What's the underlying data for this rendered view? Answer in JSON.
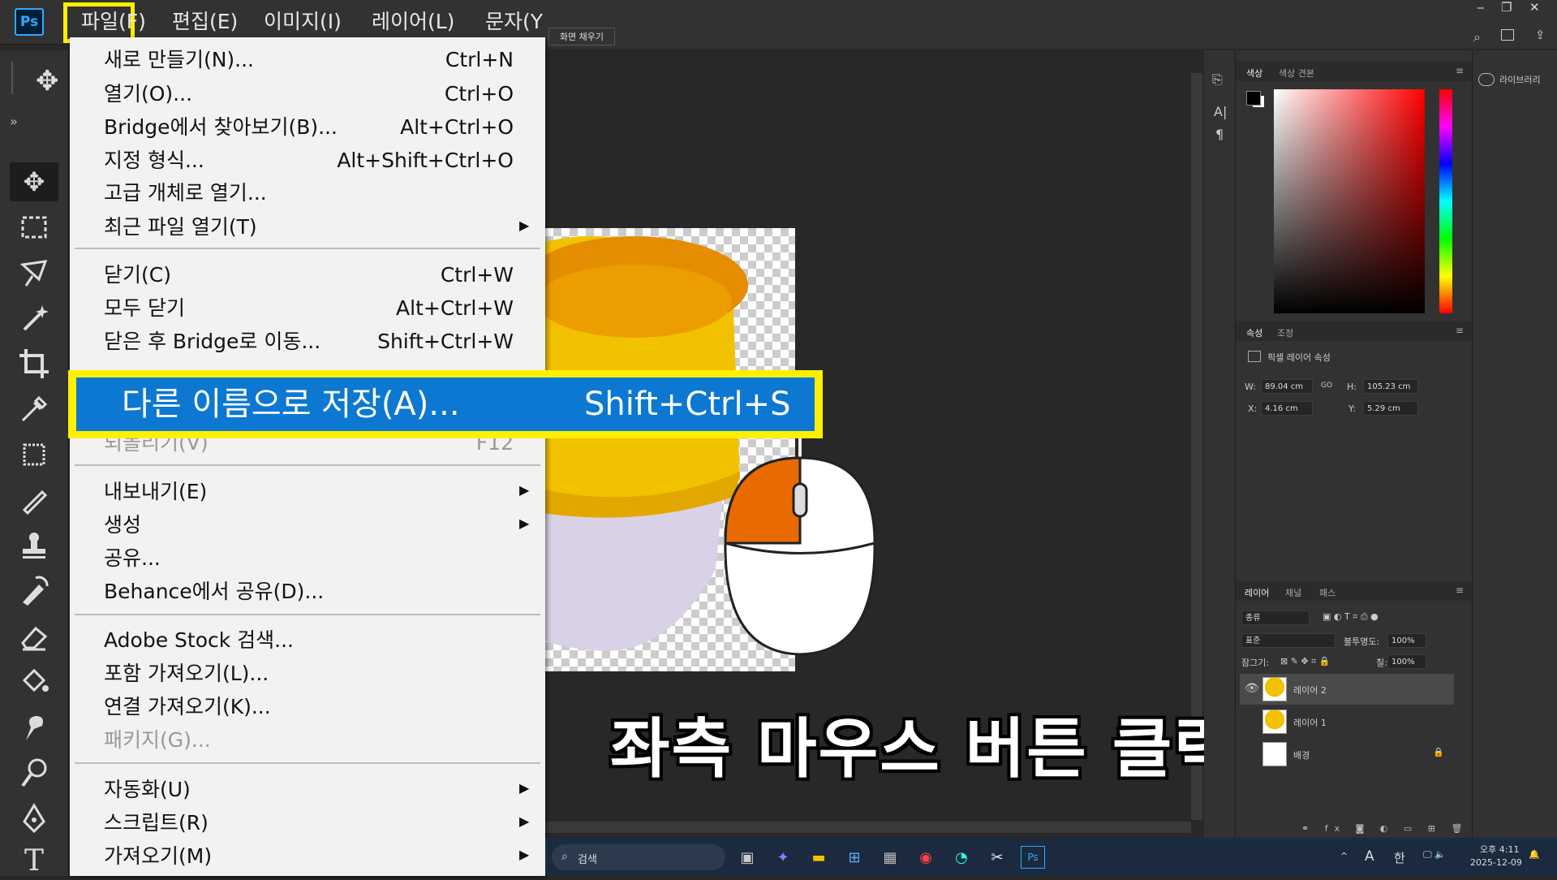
{
  "app": {
    "logo": "Ps"
  },
  "menubar": [
    "파일(F)",
    "편집(E)",
    "이미지(I)",
    "레이어(L)",
    "문자(Y"
  ],
  "window_controls": [
    "‒",
    "❐",
    "✕"
  ],
  "options_bar": {
    "fill_button": "화면 채우기"
  },
  "file_menu": {
    "items": [
      {
        "label": "새로 만들기(N)...",
        "shortcut": "Ctrl+N"
      },
      {
        "label": "열기(O)...",
        "shortcut": "Ctrl+O"
      },
      {
        "label": "Bridge에서 찾아보기(B)...",
        "shortcut": "Alt+Ctrl+O"
      },
      {
        "label": "지정 형식...",
        "shortcut": "Alt+Shift+Ctrl+O"
      },
      {
        "label": "고급 개체로 열기...",
        "shortcut": ""
      },
      {
        "label": "최근 파일 열기(T)",
        "shortcut": ""
      },
      {
        "label": "닫기(C)",
        "shortcut": "Ctrl+W"
      },
      {
        "label": "모두 닫기",
        "shortcut": "Alt+Ctrl+W"
      },
      {
        "label": "닫은 후 Bridge로 이동...",
        "shortcut": "Shift+Ctrl+W"
      },
      {
        "label": "되돌리기(V)",
        "shortcut": "F12"
      },
      {
        "label": "내보내기(E)",
        "shortcut": ""
      },
      {
        "label": "생성",
        "shortcut": ""
      },
      {
        "label": "공유...",
        "shortcut": ""
      },
      {
        "label": "Behance에서 공유(D)...",
        "shortcut": ""
      },
      {
        "label": "Adobe Stock 검색...",
        "shortcut": ""
      },
      {
        "label": "포함 가져오기(L)...",
        "shortcut": ""
      },
      {
        "label": "연결 가져오기(K)...",
        "shortcut": ""
      },
      {
        "label": "패키지(G)...",
        "shortcut": ""
      },
      {
        "label": "자동화(U)",
        "shortcut": ""
      },
      {
        "label": "스크립트(R)",
        "shortcut": ""
      },
      {
        "label": "가져오기(M)",
        "shortcut": ""
      }
    ],
    "highlighted": {
      "label": "다른 이름으로 저장(A)...",
      "shortcut": "Shift+Ctrl+S"
    }
  },
  "color_panel": {
    "tabs": [
      "색상",
      "색상 견본"
    ]
  },
  "properties_panel": {
    "tabs": [
      "속성",
      "조정"
    ],
    "title": "픽셀 레이어 속성",
    "w_label": "W:",
    "w_value": "89.04 cm",
    "h_label": "H:",
    "h_value": "105.23 cm",
    "x_label": "X:",
    "x_value": "4.16 cm",
    "y_label": "Y:",
    "y_value": "5.29 cm",
    "link": "GO"
  },
  "layers_panel": {
    "tabs": [
      "레이어",
      "채널",
      "패스"
    ],
    "filter": "종류",
    "blend": "표준",
    "opacity_label": "불투명도:",
    "opacity": "100%",
    "lock_label": "잠그기:",
    "fill_label": "칠:",
    "fill": "100%",
    "layers": [
      "레이어 2",
      "레이어 1",
      "배경"
    ]
  },
  "library": {
    "label": "라이브러리"
  },
  "caption": "좌측 마우스 버튼 클릭",
  "taskbar": {
    "search": "검색",
    "ime_a": "A",
    "ime_han": "한",
    "time": "오후 4:11",
    "date": "2025-12-09"
  },
  "colors": {
    "highlight_yellow": "#ffef00",
    "menu_selected": "#0c78d2",
    "mouse_orange": "#e86a00"
  }
}
